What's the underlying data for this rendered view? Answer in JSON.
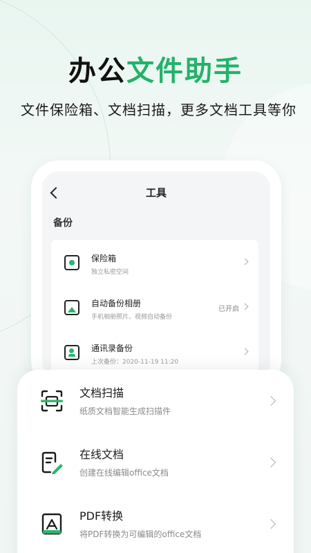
{
  "headline": {
    "part1": "办公",
    "part2": "文件助手"
  },
  "subline": "文件保险箱、文档扫描，更多文档工具等你",
  "phone": {
    "nav_title": "工具",
    "section_title": "备份",
    "items": [
      {
        "icon": "safe-icon",
        "title": "保险箱",
        "desc": "独立私密空间",
        "status": ""
      },
      {
        "icon": "photo-album-icon",
        "title": "自动备份相册",
        "desc": "手机相册照片、视频自动备份",
        "status": "已开启"
      },
      {
        "icon": "contacts-icon",
        "title": "通讯录备份",
        "desc": "上次备份：2020-11-19 11:20",
        "status": ""
      }
    ]
  },
  "tools": [
    {
      "icon": "document-scan-icon",
      "title": "文档扫描",
      "desc": "纸质文档智能生成扫描件"
    },
    {
      "icon": "online-document-icon",
      "title": "在线文档",
      "desc": "创建在线编辑office文档"
    },
    {
      "icon": "pdf-convert-icon",
      "title": "PDF转换",
      "desc": "将PDF转换为可编辑的office文档"
    }
  ],
  "colors": {
    "accent": "#22b26a",
    "background": "#eef6f2"
  }
}
